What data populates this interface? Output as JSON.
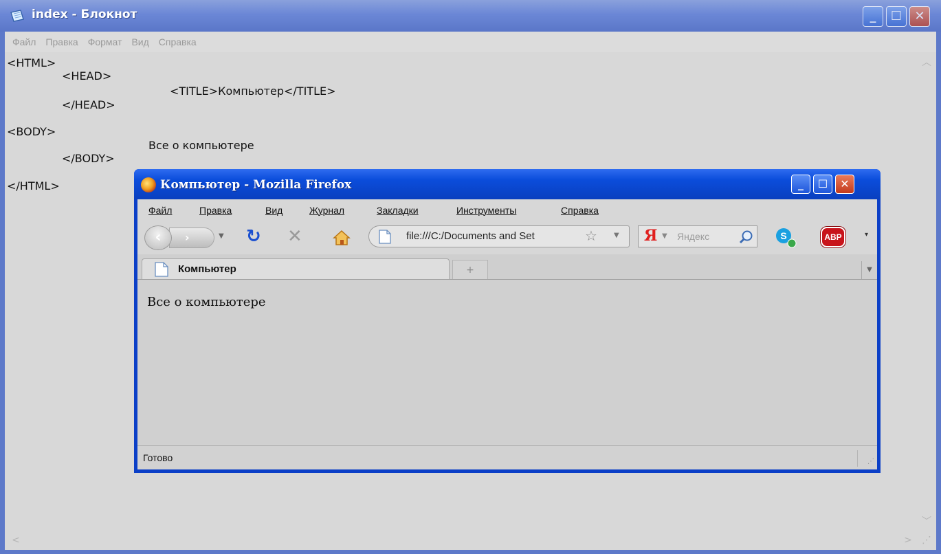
{
  "notepad": {
    "title": "index - Блокнот",
    "menu": [
      "Файл",
      "Правка",
      "Формат",
      "Вид",
      "Справка"
    ],
    "lines": [
      "<HTML>",
      "<HEAD>",
      "<TITLE>Компьютер</TITLE>",
      "</HEAD>",
      "<BODY>",
      "Все о компьютере",
      "</BODY>",
      "</HTML>"
    ]
  },
  "firefox": {
    "title": "Компьютер - Mozilla Firefox",
    "menu": [
      "Файл",
      "Правка",
      "Вид",
      "Журнал",
      "Закладки",
      "Инструменты",
      "Справка"
    ],
    "url": "file:///C:/Documents and Set",
    "search_placeholder": "Яндекс",
    "search_engine_glyph": "Я",
    "tab_label": "Компьютер",
    "page_text": "Все о компьютере",
    "status": "Готово",
    "abp_label": "ABP"
  },
  "colors": {
    "xp_blue": "#0b3fc7",
    "reload_blue": "#1a4fd0",
    "stop_gray": "#9a9a9a",
    "home_orange": "#e8a23a",
    "abp_red": "#c8141b",
    "yandex_red": "#e0201f"
  },
  "icons": {
    "notepad_app": "notepad-icon",
    "firefox_app": "firefox-icon",
    "reload": "reload-icon",
    "stop": "stop-icon",
    "home": "home-icon",
    "bookmark_star": "star-icon",
    "search_magnifier": "search-icon",
    "skype": "skype-icon",
    "adblock": "abp-icon"
  }
}
